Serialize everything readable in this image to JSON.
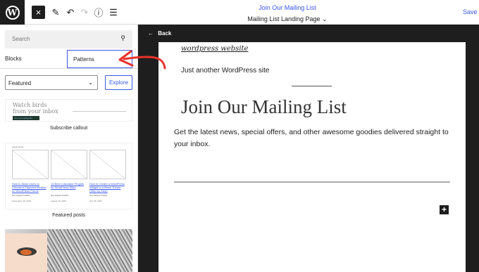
{
  "topbar": {
    "logo_letter": "W",
    "close_icon": "×",
    "pencil_icon": "✎",
    "undo_icon": "↶",
    "redo_icon": "↷",
    "info_icon": "ⓘ",
    "list_icon": "☰",
    "doc_title": "Join Our Mailing List",
    "template_label": "Mailing List Landing Page",
    "template_chevron": "⌄",
    "save_label": "Save d"
  },
  "sidebar": {
    "search_placeholder": "Search",
    "search_icon": "⚲",
    "tabs": [
      {
        "label": "Blocks"
      },
      {
        "label": "Patterns"
      }
    ],
    "category_select": "Featured",
    "select_chevron": "⌄",
    "explore_label": "Explore",
    "patterns": [
      {
        "preview_heading_line1": "Watch birds",
        "preview_heading_line2": "from your inbox",
        "preview_button": "Join our mailing list",
        "caption": "Subscribe callout"
      },
      {
        "preview_label": "Latest posts",
        "posts": [
          {
            "title": "How to Allow Users to Choose a Payment Method on WordPress Forms",
            "meta": "Get started Turkish",
            "date": "September 19, 2022"
          },
          {
            "title": "13 Best Calculator Plugins for WordPress Sites",
            "meta": "Get started Turkish",
            "date": "August 15, 2022"
          },
          {
            "title": "How to Create a WordPress Widget in a Block Theme (Step by Step)",
            "meta": "Get started Turkish",
            "date": "July 28, 2022"
          }
        ],
        "caption": "Featured posts"
      }
    ]
  },
  "canvas": {
    "back_icon": "←",
    "back_label": "Back",
    "site_title": "wordpress website",
    "tagline": "Just another WordPress site",
    "heading": "Join Our Mailing List",
    "paragraph": "Get the latest news, special offers, and other awesome goodies delivered straight to your inbox.",
    "add_block_icon": "+"
  },
  "colors": {
    "accent": "#3858e9",
    "annotation_arrow": "#e8322a",
    "dark": "#1e1e1e"
  }
}
